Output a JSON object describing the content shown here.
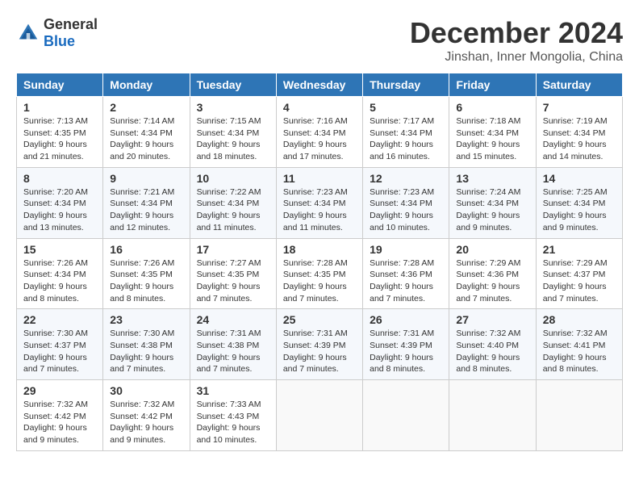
{
  "header": {
    "logo_general": "General",
    "logo_blue": "Blue",
    "month_title": "December 2024",
    "location": "Jinshan, Inner Mongolia, China"
  },
  "weekdays": [
    "Sunday",
    "Monday",
    "Tuesday",
    "Wednesday",
    "Thursday",
    "Friday",
    "Saturday"
  ],
  "weeks": [
    [
      {
        "day": "1",
        "sunrise": "7:13 AM",
        "sunset": "4:35 PM",
        "daylight": "9 hours and 21 minutes."
      },
      {
        "day": "2",
        "sunrise": "7:14 AM",
        "sunset": "4:34 PM",
        "daylight": "9 hours and 20 minutes."
      },
      {
        "day": "3",
        "sunrise": "7:15 AM",
        "sunset": "4:34 PM",
        "daylight": "9 hours and 18 minutes."
      },
      {
        "day": "4",
        "sunrise": "7:16 AM",
        "sunset": "4:34 PM",
        "daylight": "9 hours and 17 minutes."
      },
      {
        "day": "5",
        "sunrise": "7:17 AM",
        "sunset": "4:34 PM",
        "daylight": "9 hours and 16 minutes."
      },
      {
        "day": "6",
        "sunrise": "7:18 AM",
        "sunset": "4:34 PM",
        "daylight": "9 hours and 15 minutes."
      },
      {
        "day": "7",
        "sunrise": "7:19 AM",
        "sunset": "4:34 PM",
        "daylight": "9 hours and 14 minutes."
      }
    ],
    [
      {
        "day": "8",
        "sunrise": "7:20 AM",
        "sunset": "4:34 PM",
        "daylight": "9 hours and 13 minutes."
      },
      {
        "day": "9",
        "sunrise": "7:21 AM",
        "sunset": "4:34 PM",
        "daylight": "9 hours and 12 minutes."
      },
      {
        "day": "10",
        "sunrise": "7:22 AM",
        "sunset": "4:34 PM",
        "daylight": "9 hours and 11 minutes."
      },
      {
        "day": "11",
        "sunrise": "7:23 AM",
        "sunset": "4:34 PM",
        "daylight": "9 hours and 11 minutes."
      },
      {
        "day": "12",
        "sunrise": "7:23 AM",
        "sunset": "4:34 PM",
        "daylight": "9 hours and 10 minutes."
      },
      {
        "day": "13",
        "sunrise": "7:24 AM",
        "sunset": "4:34 PM",
        "daylight": "9 hours and 9 minutes."
      },
      {
        "day": "14",
        "sunrise": "7:25 AM",
        "sunset": "4:34 PM",
        "daylight": "9 hours and 9 minutes."
      }
    ],
    [
      {
        "day": "15",
        "sunrise": "7:26 AM",
        "sunset": "4:34 PM",
        "daylight": "9 hours and 8 minutes."
      },
      {
        "day": "16",
        "sunrise": "7:26 AM",
        "sunset": "4:35 PM",
        "daylight": "9 hours and 8 minutes."
      },
      {
        "day": "17",
        "sunrise": "7:27 AM",
        "sunset": "4:35 PM",
        "daylight": "9 hours and 7 minutes."
      },
      {
        "day": "18",
        "sunrise": "7:28 AM",
        "sunset": "4:35 PM",
        "daylight": "9 hours and 7 minutes."
      },
      {
        "day": "19",
        "sunrise": "7:28 AM",
        "sunset": "4:36 PM",
        "daylight": "9 hours and 7 minutes."
      },
      {
        "day": "20",
        "sunrise": "7:29 AM",
        "sunset": "4:36 PM",
        "daylight": "9 hours and 7 minutes."
      },
      {
        "day": "21",
        "sunrise": "7:29 AM",
        "sunset": "4:37 PM",
        "daylight": "9 hours and 7 minutes."
      }
    ],
    [
      {
        "day": "22",
        "sunrise": "7:30 AM",
        "sunset": "4:37 PM",
        "daylight": "9 hours and 7 minutes."
      },
      {
        "day": "23",
        "sunrise": "7:30 AM",
        "sunset": "4:38 PM",
        "daylight": "9 hours and 7 minutes."
      },
      {
        "day": "24",
        "sunrise": "7:31 AM",
        "sunset": "4:38 PM",
        "daylight": "9 hours and 7 minutes."
      },
      {
        "day": "25",
        "sunrise": "7:31 AM",
        "sunset": "4:39 PM",
        "daylight": "9 hours and 7 minutes."
      },
      {
        "day": "26",
        "sunrise": "7:31 AM",
        "sunset": "4:39 PM",
        "daylight": "9 hours and 8 minutes."
      },
      {
        "day": "27",
        "sunrise": "7:32 AM",
        "sunset": "4:40 PM",
        "daylight": "9 hours and 8 minutes."
      },
      {
        "day": "28",
        "sunrise": "7:32 AM",
        "sunset": "4:41 PM",
        "daylight": "9 hours and 8 minutes."
      }
    ],
    [
      {
        "day": "29",
        "sunrise": "7:32 AM",
        "sunset": "4:42 PM",
        "daylight": "9 hours and 9 minutes."
      },
      {
        "day": "30",
        "sunrise": "7:32 AM",
        "sunset": "4:42 PM",
        "daylight": "9 hours and 9 minutes."
      },
      {
        "day": "31",
        "sunrise": "7:33 AM",
        "sunset": "4:43 PM",
        "daylight": "9 hours and 10 minutes."
      },
      null,
      null,
      null,
      null
    ]
  ],
  "labels": {
    "sunrise": "Sunrise:",
    "sunset": "Sunset:",
    "daylight": "Daylight:"
  }
}
